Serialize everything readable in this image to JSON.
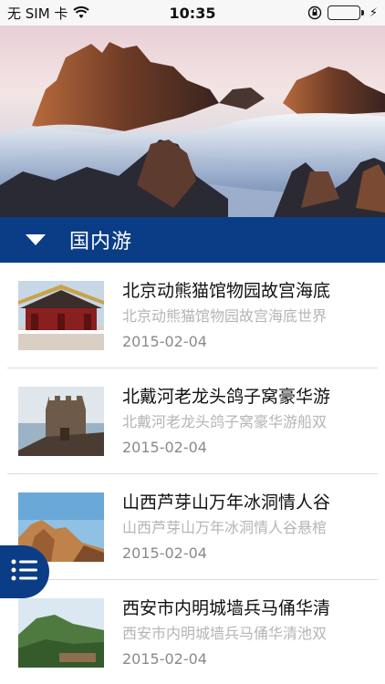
{
  "status_bar": {
    "carrier": "无 SIM 卡",
    "time": "10:35",
    "icons": [
      "wifi-icon",
      "orientation-lock-icon",
      "battery-icon",
      "charging-icon"
    ]
  },
  "hero": {
    "image": "mountain-peaks-sea-of-clouds"
  },
  "section": {
    "title": "国内游",
    "icon": "caret-down-icon"
  },
  "items": [
    {
      "title": "北京动熊猫馆物园故宫海底",
      "subtitle": "北京动熊猫馆物园故宫海底世界",
      "date": "2015-02-04",
      "thumb": "palace-gate"
    },
    {
      "title": "北戴河老龙头鸽子窝豪华游",
      "subtitle": "北戴河老龙头鸽子窝豪华游船双",
      "date": "2015-02-04",
      "thumb": "great-wall-by-sea"
    },
    {
      "title": "山西芦芽山万年冰洞情人谷",
      "subtitle": "山西芦芽山万年冰洞情人谷悬棺",
      "date": "2015-02-04",
      "thumb": "rocky-peak"
    },
    {
      "title": "西安市内明城墙兵马俑华清",
      "subtitle": "西安市内明城墙兵马俑华清池双",
      "date": "2015-02-04",
      "thumb": "green-mountain"
    }
  ],
  "fab": {
    "icon": "list-menu-icon"
  },
  "colors": {
    "primary": "#0a3d86",
    "subtitle": "#b5b5b5",
    "date": "#8a8a8a"
  }
}
